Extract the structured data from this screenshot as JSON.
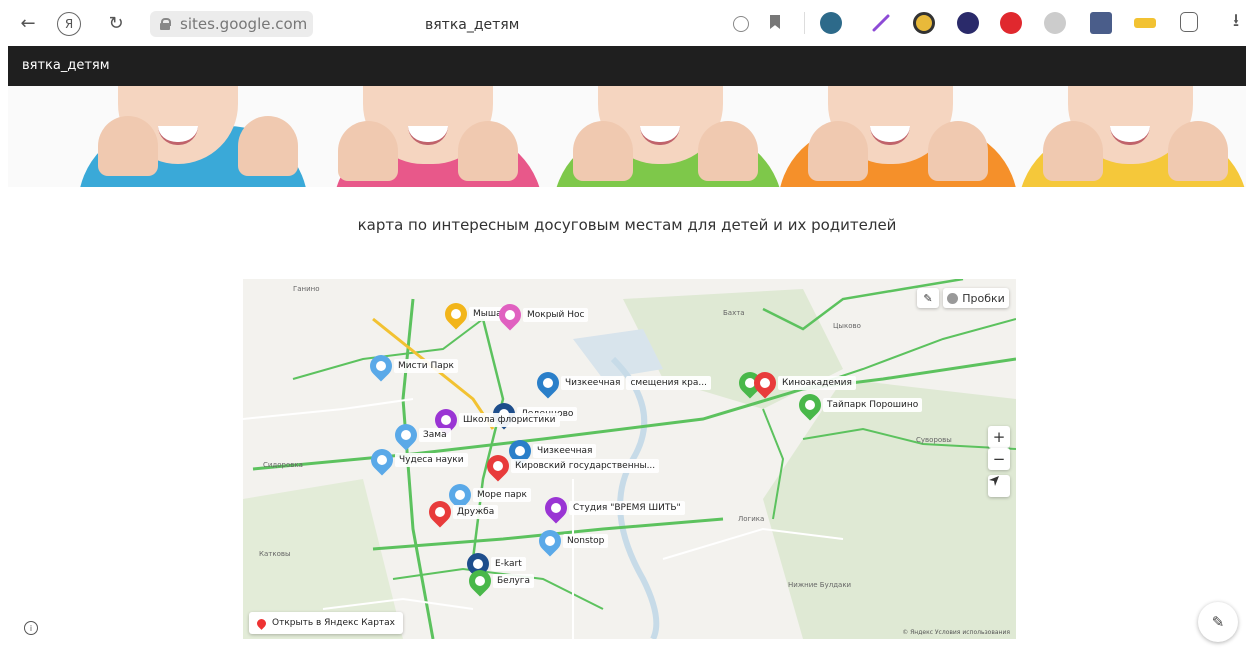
{
  "browser": {
    "address": "sites.google.com",
    "tab_title": "вятка_детям",
    "back_icon": "←",
    "yandex_icon": "Я",
    "reload_icon": "↻",
    "download_icon": "⭳"
  },
  "site": {
    "name": "вятка_детям"
  },
  "main": {
    "heading": "карта по интересным досуговым местам для детей и их родителей"
  },
  "map": {
    "traffic_label": "Пробки",
    "zoom_in": "+",
    "zoom_out": "−",
    "open_label": "Открыть в Яндекс Картах",
    "copyright": "© Яндекс  Условия использования",
    "places": [
      "Ганино",
      "Бахта",
      "Цыково",
      "Сидоровка",
      "Суворовы",
      "Катковы",
      "Нижние Булдаки",
      "Логика"
    ],
    "markers": [
      {
        "label": "Мыша",
        "color": "#f2b51a"
      },
      {
        "label": "Мокрый Нос",
        "color": "#e060c0"
      },
      {
        "label": "Мисти Парк",
        "color": "#5aa9e8"
      },
      {
        "label": "Чизкеечная",
        "color": "#2a7fc9"
      },
      {
        "label": "смещения кра...",
        "color": "#2a7fc9"
      },
      {
        "label": "Киноакадемия",
        "color": "#e83b3b"
      },
      {
        "label": "Тайпарк Порошино",
        "color": "#49b84a"
      },
      {
        "label": "Леденцово",
        "color": "#1e4e8c"
      },
      {
        "label": "Школа флористики",
        "color": "#9a35d4"
      },
      {
        "label": "Зама",
        "color": "#5aa9e8"
      },
      {
        "label": "Чудеса науки",
        "color": "#5aa9e8"
      },
      {
        "label": "Чизкеечная",
        "color": "#2a7fc9"
      },
      {
        "label": "Кировский государственны...",
        "color": "#e83b3b"
      },
      {
        "label": "Море парк",
        "color": "#5aa9e8"
      },
      {
        "label": "Дружба",
        "color": "#e83b3b"
      },
      {
        "label": "Студия \"ВРЕМЯ ШИТЬ\"",
        "color": "#9a35d4"
      },
      {
        "label": "Nonstop",
        "color": "#5aa9e8"
      },
      {
        "label": "E-kart",
        "color": "#1e4e8c"
      },
      {
        "label": "Белуга",
        "color": "#49b84a"
      }
    ]
  },
  "extensions": [
    "#2d6a8a",
    "#8d4bd6",
    "#e8b93a",
    "#2a2a6a",
    "#e0282e",
    "#cccccc",
    "#4a5d8a",
    "#f2c232"
  ]
}
